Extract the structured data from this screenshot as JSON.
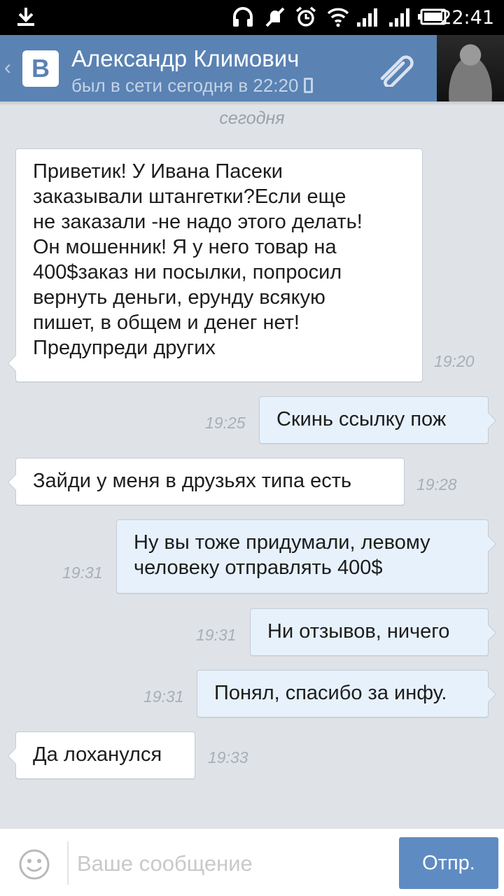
{
  "status_bar": {
    "time": "22:41"
  },
  "header": {
    "contact_name": "Александр Климович",
    "contact_status": "был в сети сегодня в 22:20"
  },
  "chat": {
    "date_separator": "сегодня",
    "messages": [
      {
        "direction": "in",
        "text": "Приветик! У Ивана Пасеки\nзаказывали штангетки?Если еще\nне заказали -не надо этого делать!\nОн мошенник! Я у него товар на\n400$заказ ни посылки, попросил\nвернуть деньги, ерунду всякую\nпишет, в общем и денег нет!\nПредупреди других",
        "time": "19:20"
      },
      {
        "direction": "out",
        "text": "Скинь ссылку пож",
        "time": "19:25"
      },
      {
        "direction": "in",
        "text": "Зайди у меня в друзьях типа есть",
        "time": "19:28"
      },
      {
        "direction": "out",
        "text": "Ну вы тоже придумали, левому\nчеловеку отправлять 400$",
        "time": "19:31"
      },
      {
        "direction": "out",
        "text": "Ни отзывов, ничего",
        "time": "19:31"
      },
      {
        "direction": "out",
        "text": "Понял, спасибо за инфу.",
        "time": "19:31"
      },
      {
        "direction": "in",
        "text": "Да лоханулся",
        "time": "19:33"
      }
    ]
  },
  "input_bar": {
    "placeholder": "Ваше сообщение",
    "send_label": "Отпр."
  },
  "colors": {
    "header_bg": "#5a82b3",
    "incoming_bubble": "#ffffff",
    "outgoing_bubble": "#e6f1fb",
    "send_button": "#5f8bc3"
  }
}
